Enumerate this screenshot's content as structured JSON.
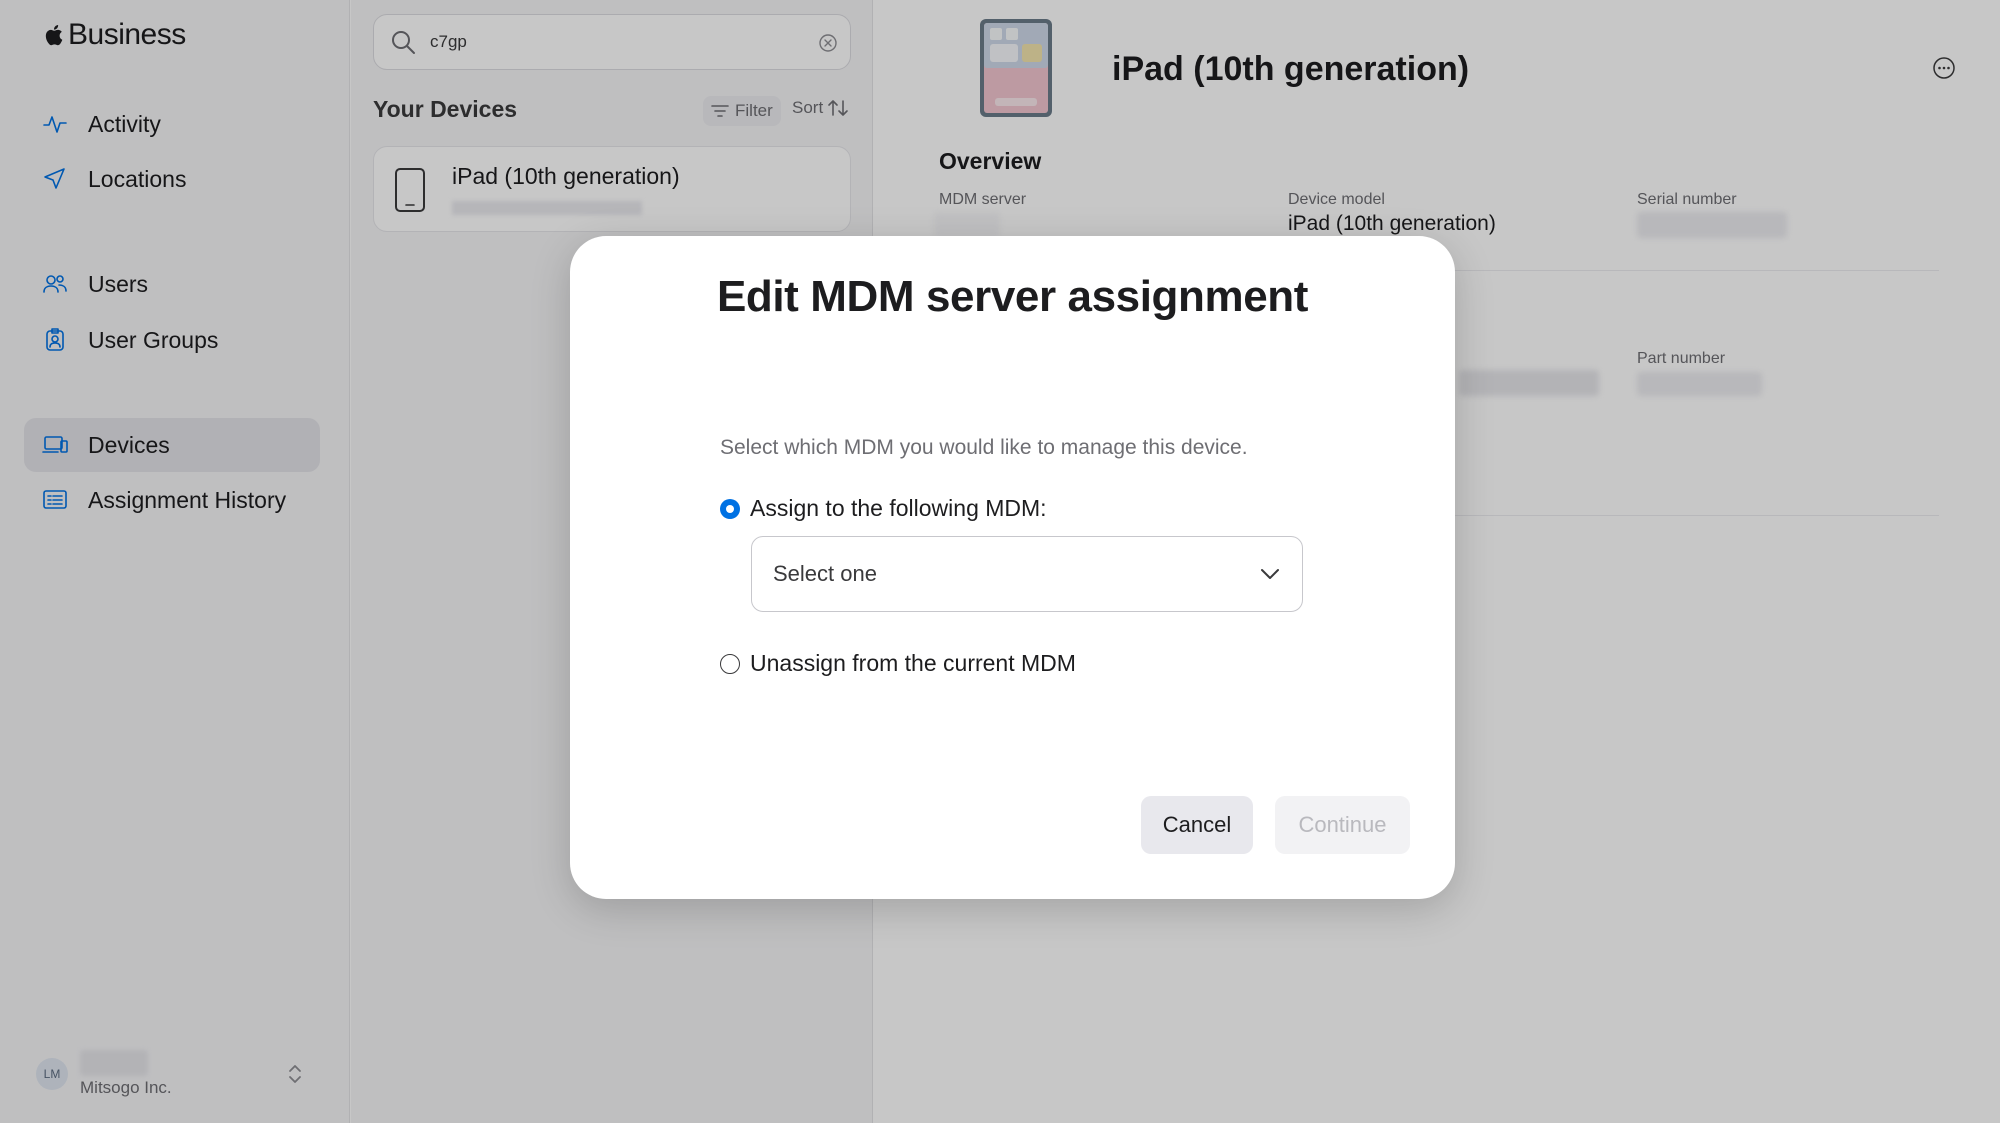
{
  "sidebar": {
    "brand": "Business",
    "items": [
      {
        "label": "Activity",
        "icon": "activity-icon"
      },
      {
        "label": "Locations",
        "icon": "location-arrow-icon"
      },
      {
        "label": "Users",
        "icon": "users-icon"
      },
      {
        "label": "User Groups",
        "icon": "user-groups-icon"
      },
      {
        "label": "Devices",
        "icon": "devices-icon",
        "active": true
      },
      {
        "label": "Assignment History",
        "icon": "history-list-icon"
      }
    ],
    "account": {
      "initials": "LM",
      "org": "Mitsogo Inc."
    }
  },
  "device_list": {
    "search": {
      "value": "c7gp"
    },
    "title": "Your Devices",
    "filter_label": "Filter",
    "sort_label": "Sort",
    "devices": [
      {
        "name": "iPad (10th generation)"
      }
    ]
  },
  "detail": {
    "title": "iPad (10th generation)",
    "section": "Overview",
    "fields": {
      "mdm_server_label": "MDM server",
      "device_model_label": "Device model",
      "device_model_value": "iPad (10th generation)",
      "serial_number_label": "Serial number",
      "part_number_label": "Part number"
    }
  },
  "modal": {
    "title": "Edit MDM server assignment",
    "description": "Select which MDM you would like to manage this device.",
    "option_assign": "Assign to the following MDM:",
    "select_value": "Select one",
    "option_unassign": "Unassign from the current MDM",
    "selected_option": "assign",
    "cancel_label": "Cancel",
    "continue_label": "Continue",
    "continue_enabled": false
  },
  "colors": {
    "accent": "#0071e3",
    "scrim": "rgba(0,0,0,0.22)"
  }
}
